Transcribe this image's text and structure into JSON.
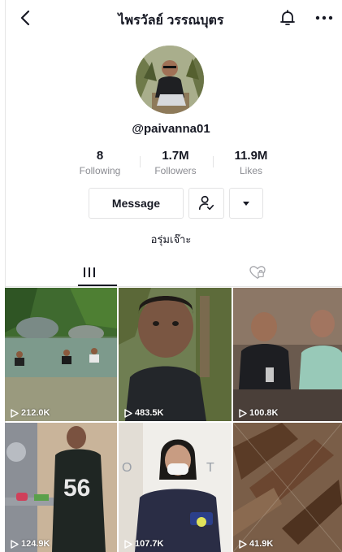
{
  "header": {
    "title": "ไพรวัลย์ วรรณบุตร",
    "back_icon": "chevron-left-icon",
    "bell_icon": "bell-icon",
    "more_icon": "more-horizontal-icon"
  },
  "profile": {
    "username": "@paivanna01",
    "bio": "อรุ่มเจ๊าะ"
  },
  "stats": [
    {
      "value": "8",
      "label": "Following"
    },
    {
      "value": "1.7M",
      "label": "Followers"
    },
    {
      "value": "11.9M",
      "label": "Likes"
    }
  ],
  "actions": {
    "message_label": "Message",
    "follow_icon": "user-check-icon",
    "dropdown_icon": "caret-down-icon"
  },
  "tabs": [
    {
      "name": "videos",
      "icon": "grid-lines-icon"
    },
    {
      "name": "liked",
      "icon": "heart-lock-icon"
    }
  ],
  "videos": [
    {
      "views": "212.0K"
    },
    {
      "views": "483.5K"
    },
    {
      "views": "100.8K"
    },
    {
      "views": "124.9K"
    },
    {
      "views": "107.7K"
    },
    {
      "views": "41.9K"
    }
  ]
}
